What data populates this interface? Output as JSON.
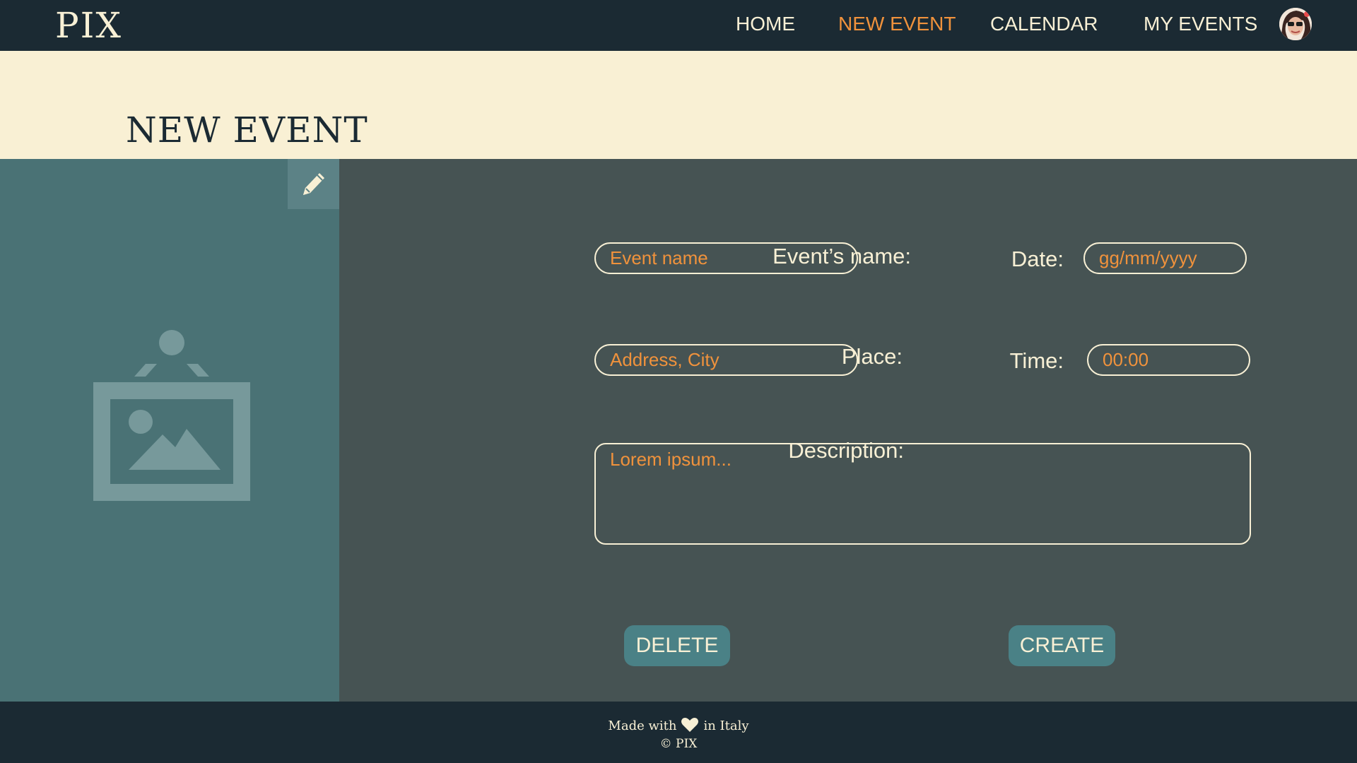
{
  "app": {
    "logo": "PIX"
  },
  "nav": {
    "items": [
      {
        "label": "HOME",
        "active": false
      },
      {
        "label": "NEW EVENT",
        "active": true
      },
      {
        "label": "CALENDAR",
        "active": false
      },
      {
        "label": "MY EVENTS",
        "active": false
      }
    ],
    "avatar_icon": "user-avatar-icon"
  },
  "page": {
    "title": "NEW EVENT"
  },
  "image_panel": {
    "edit_icon": "pencil-icon",
    "placeholder_icon": "framed-picture-icon"
  },
  "form": {
    "name": {
      "label": "Event’s name:",
      "placeholder": "Event name",
      "value": ""
    },
    "date": {
      "label": "Date:",
      "placeholder": "gg/mm/yyyy",
      "value": ""
    },
    "place": {
      "label": "Place:",
      "placeholder": "Address, City",
      "value": ""
    },
    "time": {
      "label": "Time:",
      "placeholder": "00:00",
      "value": ""
    },
    "description": {
      "label": "Description:",
      "placeholder": "Lorem ipsum...",
      "value": ""
    }
  },
  "actions": {
    "delete_label": "DELETE",
    "create_label": "CREATE"
  },
  "footer": {
    "made_with": "Made with",
    "in_country": "in Italy",
    "heart_icon": "heart-icon",
    "copyright": "© PIX"
  },
  "colors": {
    "dark_navy": "#1b2a33",
    "cream": "#f9f0d4",
    "accent_orange": "#f0923c",
    "teal_panel": "#4a7275",
    "form_panel": "#465353",
    "button_teal": "#4a8186"
  }
}
